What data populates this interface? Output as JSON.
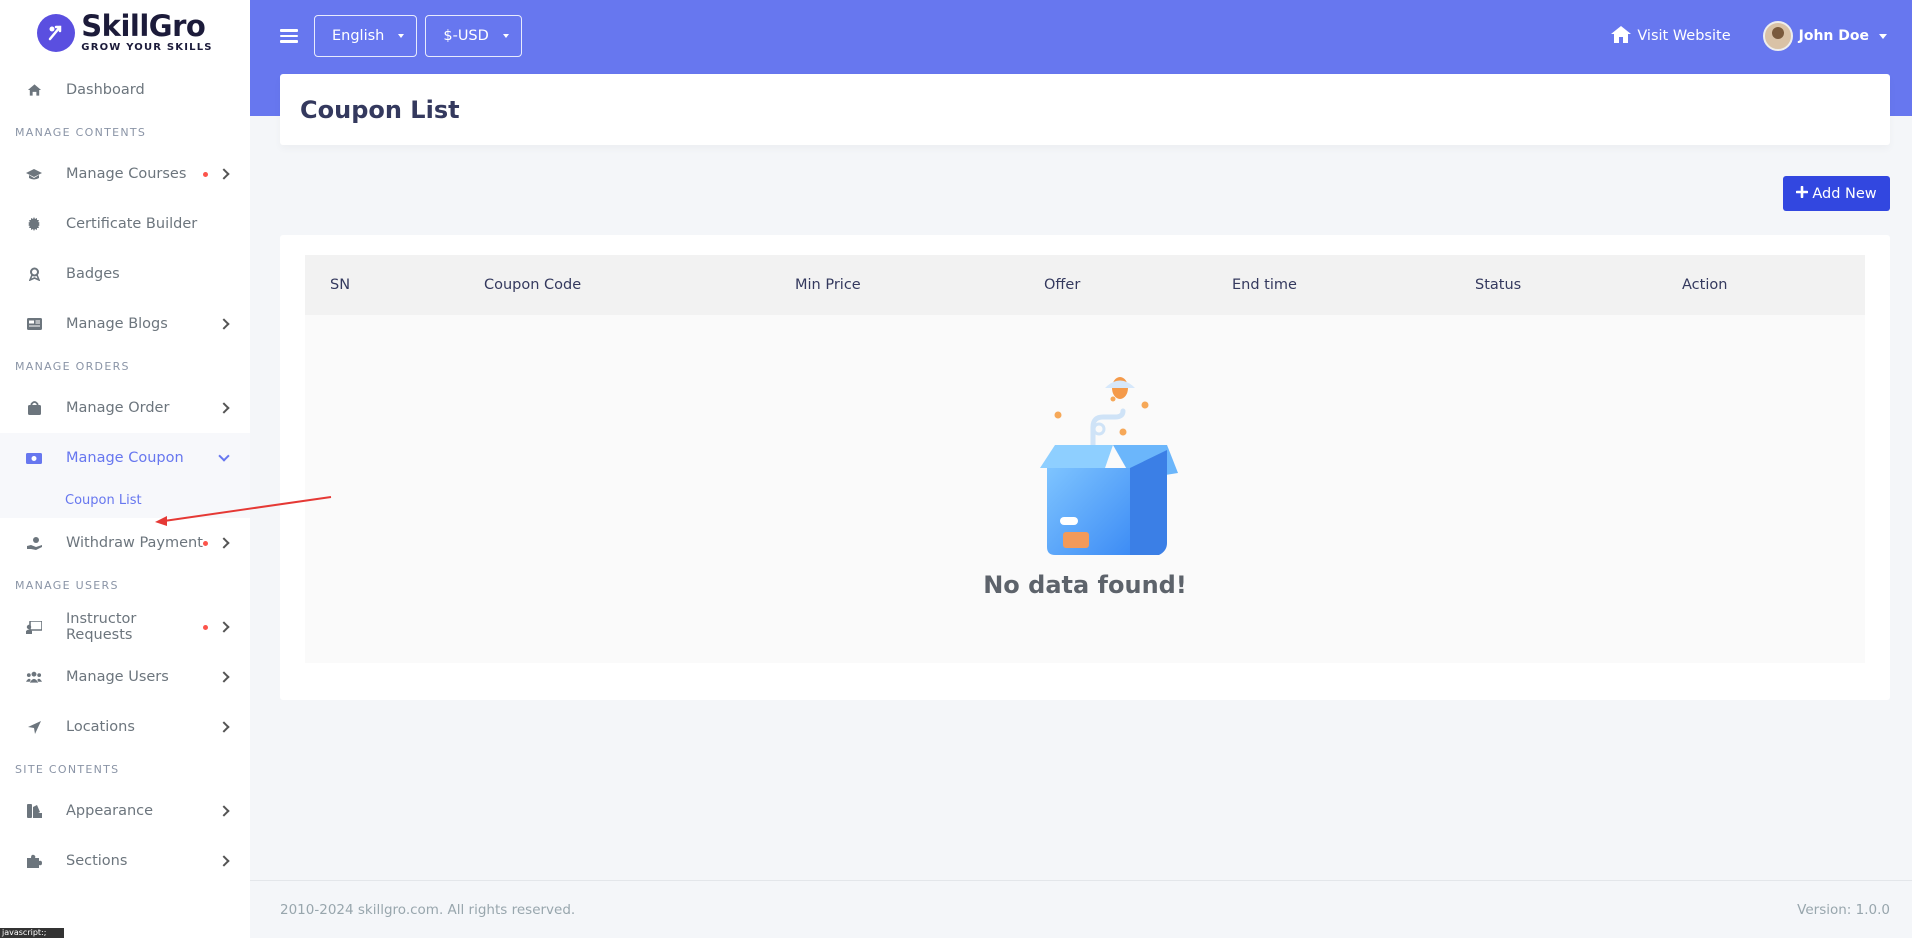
{
  "brand": {
    "name": "SkillGro",
    "tagline": "GROW YOUR SKILLS"
  },
  "sidebar": {
    "dashboard": "Dashboard",
    "headers": [
      "MANAGE CONTENTS",
      "MANAGE ORDERS",
      "MANAGE USERS",
      "SITE CONTENTS"
    ],
    "items": {
      "manage_courses": "Manage Courses",
      "certificate_builder": "Certificate Builder",
      "badges": "Badges",
      "manage_blogs": "Manage Blogs",
      "manage_order": "Manage Order",
      "manage_coupon": "Manage Coupon",
      "coupon_list": "Coupon List",
      "withdraw_payment": "Withdraw Payment",
      "instructor_requests": "Instructor Requests",
      "manage_users": "Manage Users",
      "locations": "Locations",
      "appearance": "Appearance",
      "sections": "Sections"
    }
  },
  "tooltip": "javascript:;",
  "topbar": {
    "language": "English",
    "currency": "$-USD",
    "visit_website": "Visit Website",
    "user_name": "John Doe"
  },
  "page": {
    "title": "Coupon List",
    "add_new": "Add New"
  },
  "table": {
    "columns": [
      "SN",
      "Coupon Code",
      "Min Price",
      "Offer",
      "End time",
      "Status",
      "Action"
    ],
    "empty_message": "No data found!"
  },
  "footer": {
    "copyright": "2010-2024 skillgro.com. All rights reserved.",
    "version": "Version: 1.0.0"
  },
  "colors": {
    "primary": "#6777ef",
    "button": "#3247e0",
    "badge_dot": "#fc544b",
    "annotation": "#e53935"
  }
}
